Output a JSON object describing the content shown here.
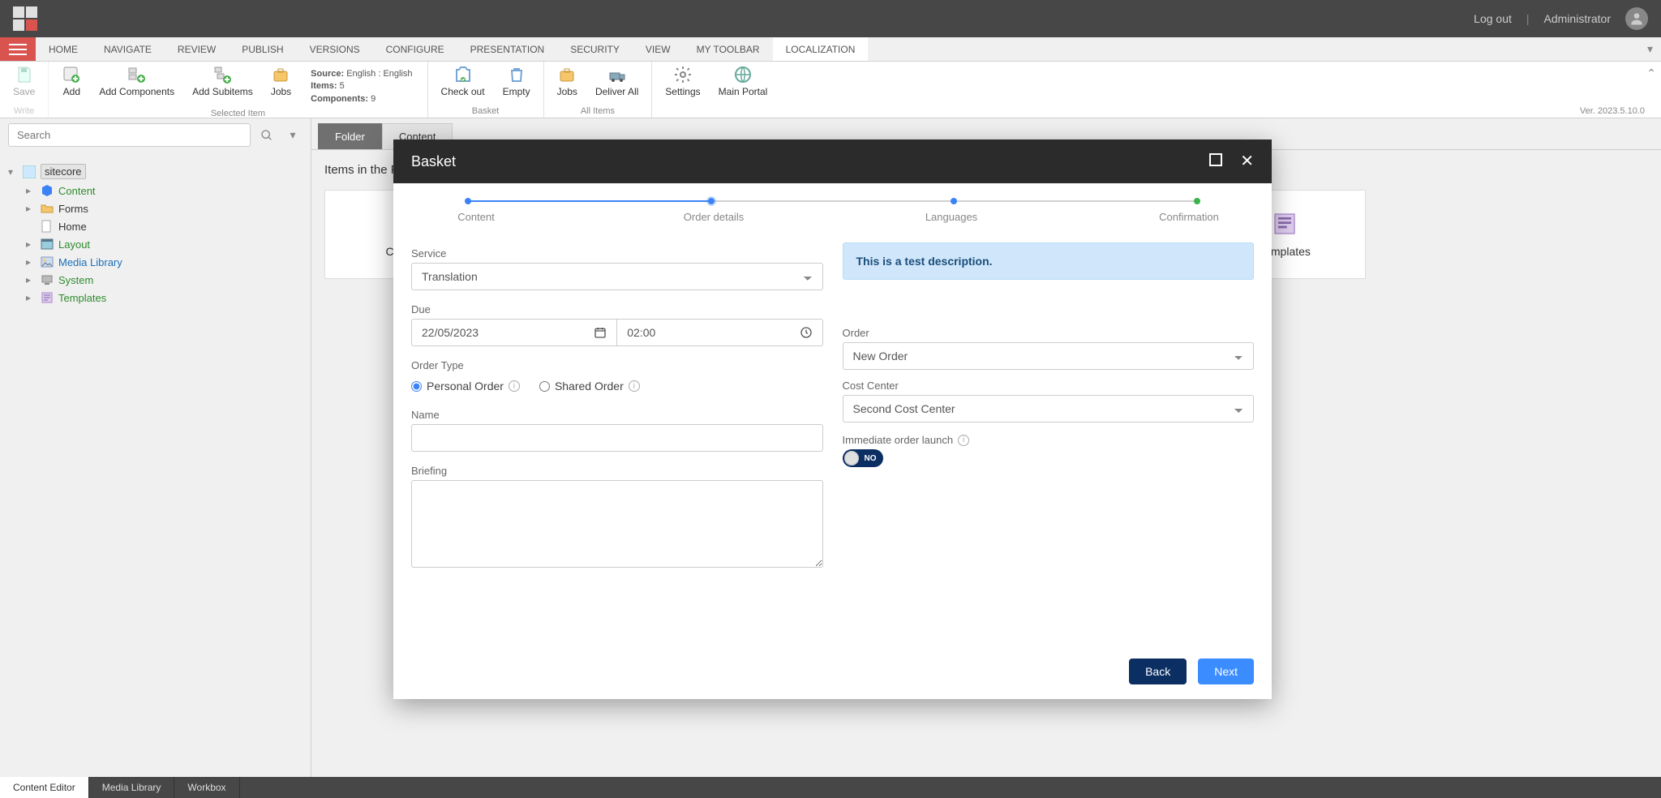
{
  "topbar": {
    "logout": "Log out",
    "user": "Administrator"
  },
  "ribbontabs": [
    "HOME",
    "NAVIGATE",
    "REVIEW",
    "PUBLISH",
    "VERSIONS",
    "CONFIGURE",
    "PRESENTATION",
    "SECURITY",
    "VIEW",
    "MY TOOLBAR",
    "LOCALIZATION"
  ],
  "ribbon": {
    "group_write": {
      "save": "Save",
      "title": "Write"
    },
    "group_selected": {
      "add": "Add",
      "addcomp": "Add Components",
      "addsub": "Add Subitems",
      "jobs": "Jobs",
      "title": "Selected Item",
      "info_source_k": "Source:",
      "info_source_v": "English : English",
      "info_items_k": "Items:",
      "info_items_v": "5",
      "info_comp_k": "Components:",
      "info_comp_v": "9"
    },
    "group_basket": {
      "checkout": "Check out",
      "empty": "Empty",
      "title": "Basket"
    },
    "group_all": {
      "jobs": "Jobs",
      "deliver": "Deliver All",
      "title": "All Items"
    },
    "group_last": {
      "settings": "Settings",
      "mainportal": "Main Portal"
    },
    "version": "Ver. 2023.5.10.0"
  },
  "sidebar": {
    "search_placeholder": "Search",
    "root": "sitecore",
    "items": [
      "Content",
      "Forms",
      "Home",
      "Layout",
      "Media Library",
      "System",
      "Templates"
    ]
  },
  "subtabs": {
    "folder": "Folder",
    "content": "Content"
  },
  "page": {
    "title": "Items in the Folder",
    "card_content": "Content",
    "card_templates": "Templates"
  },
  "bottom": {
    "ce": "Content Editor",
    "ml": "Media Library",
    "wb": "Workbox"
  },
  "modal": {
    "title": "Basket",
    "steps": [
      "Content",
      "Order details",
      "Languages",
      "Confirmation"
    ],
    "info": "This is a test description.",
    "labels": {
      "service": "Service",
      "due": "Due",
      "ordertype": "Order Type",
      "personal": "Personal Order",
      "shared": "Shared Order",
      "name": "Name",
      "briefing": "Briefing",
      "order": "Order",
      "costcenter": "Cost Center",
      "immediate": "Immediate order launch"
    },
    "values": {
      "service": "Translation",
      "date": "22/05/2023",
      "time": "02:00",
      "order": "New Order",
      "costcenter": "Second Cost Center",
      "toggle": "NO"
    },
    "buttons": {
      "back": "Back",
      "next": "Next"
    }
  }
}
